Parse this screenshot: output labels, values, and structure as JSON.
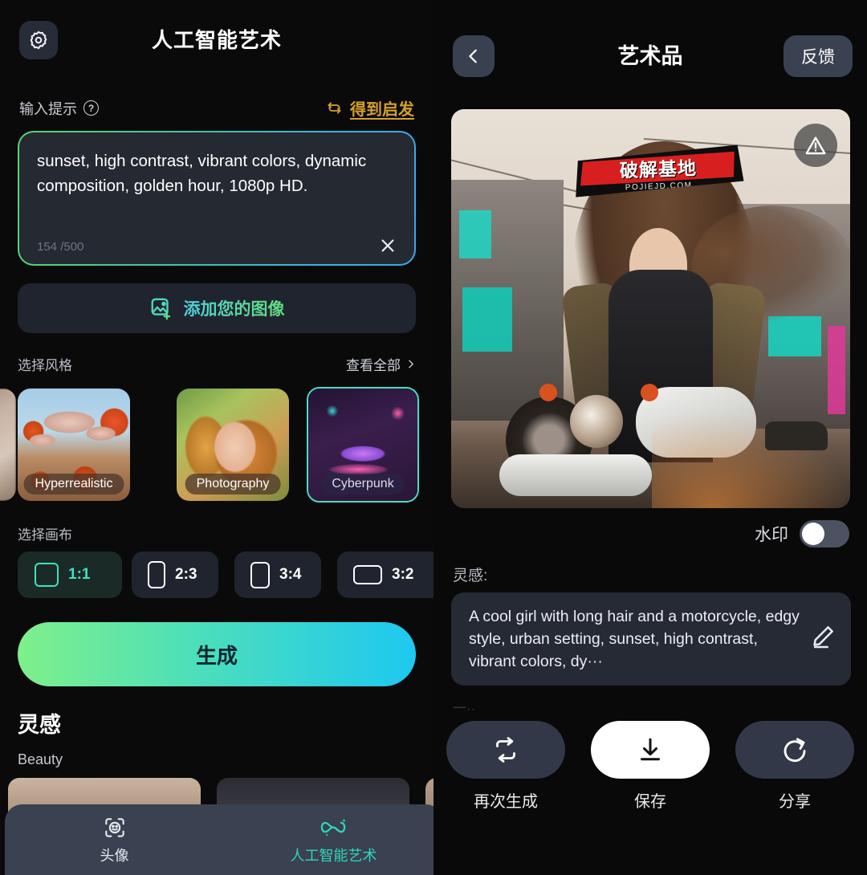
{
  "left_panel": {
    "header": {
      "gear_icon": "gear-icon",
      "title": "人工智能艺术"
    },
    "prompt_section": {
      "label": "输入提示",
      "help_icon": "question-icon",
      "inspire_icon": "refresh-icon",
      "inspire_label": "得到启发",
      "prompt_value": "sunset, high contrast, vibrant colors, dynamic composition, golden hour, 1080p HD.",
      "counter": "154 /500",
      "clear_icon": "close-icon"
    },
    "add_image_button": {
      "icon": "image-plus-icon",
      "label": "添加您的图像"
    },
    "styles_section": {
      "title": "选择风格",
      "see_all": "查看全部",
      "chevron_icon": "chevron-right-icon",
      "cards": [
        {
          "name": "",
          "selected": false
        },
        {
          "name": "Hyperrealistic",
          "selected": false
        },
        {
          "name": "Photography",
          "selected": false
        },
        {
          "name": "Cyberpunk",
          "selected": true
        }
      ]
    },
    "canvas_section": {
      "title": "选择画布",
      "ratios": [
        {
          "label": "1:1",
          "selected": true
        },
        {
          "label": "2:3",
          "selected": false
        },
        {
          "label": "3:4",
          "selected": false
        },
        {
          "label": "3:2",
          "selected": false
        }
      ]
    },
    "generate_button": "生成",
    "inspiration": {
      "title": "灵感",
      "category": "Beauty"
    },
    "tabbar": [
      {
        "label": "头像",
        "icon": "face-scan-icon",
        "active": false
      },
      {
        "label": "人工智能艺术",
        "icon": "ai-sparkle-icon",
        "active": true
      }
    ]
  },
  "right_panel": {
    "header": {
      "back_icon": "chevron-left-icon",
      "title": "艺术品",
      "feedback_label": "反馈"
    },
    "artwork": {
      "warning_icon": "warning-icon",
      "watermark_text": "破解基地",
      "watermark_url": "POJIEJD.COM"
    },
    "watermark_toggle": {
      "label": "水印",
      "on": false
    },
    "inspiration": {
      "label": "灵感:",
      "text": "A cool girl with long hair and a motorcycle, edgy style, urban setting, sunset, high contrast, vibrant colors, dy···",
      "edit_icon": "pencil-icon"
    },
    "faint_text": "一··",
    "actions": [
      {
        "label": "再次生成",
        "icon": "regenerate-icon",
        "primary": false
      },
      {
        "label": "保存",
        "icon": "download-icon",
        "primary": true
      },
      {
        "label": "分享",
        "icon": "share-icon",
        "primary": false
      }
    ]
  },
  "colors": {
    "accent_teal": "#2fd5bb",
    "accent_gold": "#d5a12a",
    "generate_from": "#7ff08a",
    "generate_to": "#1ec8f0",
    "panel_bg": "#0a0a0b",
    "card_bg": "#20242e"
  }
}
